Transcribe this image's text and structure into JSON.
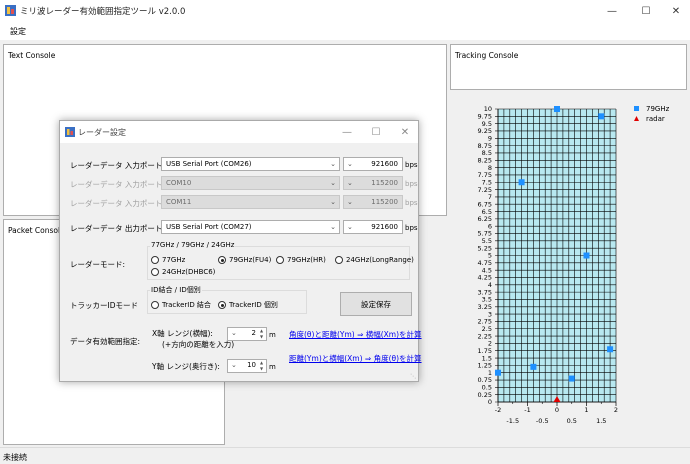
{
  "window": {
    "title": "ミリ波レーダー有効範囲指定ツール v2.0.0"
  },
  "menu": {
    "settings": "設定"
  },
  "panels": {
    "text_console": "Text Console",
    "packet_console": "Packet Console",
    "tracking_console": "Tracking Console"
  },
  "status": {
    "text": "未接続"
  },
  "dialog": {
    "title": "レーダー設定",
    "input_port_label": "レーダーデータ 入力ポート:",
    "input_port_value": "USB Serial Port (COM26)",
    "input_baud": "921600",
    "input_port_b_label": "レーダーデータ 入力ポートB:",
    "input_port_b_value": "COM10",
    "input_b_baud": "115200",
    "input_port_c_label": "レーダーデータ 入力ポートC:",
    "input_port_c_value": "COM11",
    "input_c_baud": "115200",
    "output_port_label": "レーダーデータ 出力ポート:",
    "output_port_value": "USB Serial Port (COM27)",
    "output_baud": "921600",
    "baud_unit": "bps",
    "mode_label": "レーダーモード:",
    "mode_group_title": "77GHz / 79GHz / 24GHz",
    "mode_options": [
      "77GHz",
      "79GHz(FU4)",
      "79GHz(HR)",
      "24GHz(LongRange)",
      "24GHz(DHBC6)"
    ],
    "tracker_label": "トラッカーIDモード",
    "tracker_group_title": "ID結合 / ID個別",
    "tracker_options": [
      "TrackerID 結合",
      "TrackerID 個別"
    ],
    "save_button": "設定保存",
    "range_label": "データ有効範囲指定:",
    "x_range_label": "X軸 レンジ(横幅):",
    "x_range_hint": "(+方向の距離を入力)",
    "x_range_value": "2",
    "y_range_label": "Y軸 レンジ(奥行き):",
    "y_range_value": "10",
    "range_unit": "m",
    "link_angle": "角度(θ)と距離(Ym) ⇒ 横幅(Xm)を計算",
    "link_distance": "距離(Ym)と横幅(Xm) ⇒ 角度(θ)を計算"
  },
  "colors": {
    "accent": "#0078d7",
    "series": "#1e90ff",
    "radar": "#e00000",
    "plot_bg": "#b8e8f0",
    "grid": "#000000"
  },
  "chart_data": {
    "type": "scatter",
    "xlim": [
      -2,
      2
    ],
    "ylim": [
      0,
      10
    ],
    "x_ticks_major": [
      "-2",
      "-1",
      "0",
      "1",
      "2"
    ],
    "x_ticks_minor": [
      "-1.5",
      "-0.5",
      "0.5",
      "1.5"
    ],
    "y_ticks": [
      "0",
      "0.25",
      "0.5",
      "0.75",
      "1",
      "1.25",
      "1.5",
      "1.75",
      "2",
      "2.25",
      "2.5",
      "2.75",
      "3",
      "3.25",
      "3.5",
      "3.75",
      "4",
      "4.25",
      "4.5",
      "4.75",
      "5",
      "5.25",
      "5.5",
      "5.75",
      "6",
      "6.25",
      "6.5",
      "6.75",
      "7",
      "7.25",
      "7.5",
      "7.75",
      "8",
      "8.25",
      "8.5",
      "8.75",
      "9",
      "9.25",
      "9.5",
      "9.75",
      "10"
    ],
    "grid": true,
    "legend_position": "top-right",
    "series": [
      {
        "name": "79GHz",
        "marker": "square",
        "points": [
          [
            -2,
            1.0
          ],
          [
            -1.2,
            7.5
          ],
          [
            0,
            10.0
          ],
          [
            1.5,
            9.75
          ],
          [
            -0.8,
            1.2
          ],
          [
            0.5,
            0.8
          ],
          [
            1.0,
            5.0
          ],
          [
            1.8,
            1.8
          ]
        ]
      },
      {
        "name": "radar",
        "marker": "triangle",
        "points": [
          [
            0,
            0
          ]
        ]
      }
    ]
  }
}
